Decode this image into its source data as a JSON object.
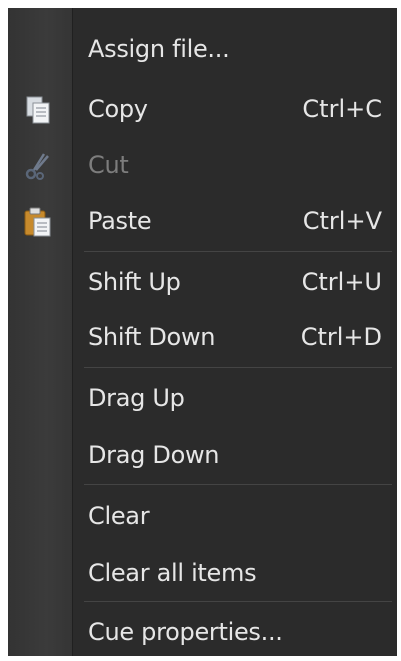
{
  "menu": {
    "items": [
      {
        "label": "Assign file...",
        "shortcut": "",
        "enabled": true,
        "icon": null
      },
      {
        "label": "Copy",
        "shortcut": "Ctrl+C",
        "enabled": true,
        "icon": "copy-icon"
      },
      {
        "label": "Cut",
        "shortcut": "",
        "enabled": false,
        "icon": "scissors-icon"
      },
      {
        "label": "Paste",
        "shortcut": "Ctrl+V",
        "enabled": true,
        "icon": "clipboard-paste-icon"
      },
      {
        "label": "Shift Up",
        "shortcut": "Ctrl+U",
        "enabled": true,
        "icon": null
      },
      {
        "label": "Shift Down",
        "shortcut": "Ctrl+D",
        "enabled": true,
        "icon": null
      },
      {
        "label": "Drag Up",
        "shortcut": "",
        "enabled": true,
        "icon": null
      },
      {
        "label": "Drag Down",
        "shortcut": "",
        "enabled": true,
        "icon": null
      },
      {
        "label": "Clear",
        "shortcut": "",
        "enabled": true,
        "icon": null
      },
      {
        "label": "Clear all items",
        "shortcut": "",
        "enabled": true,
        "icon": null
      },
      {
        "label": "Cue properties...",
        "shortcut": "",
        "enabled": true,
        "icon": null
      }
    ]
  },
  "colors": {
    "menu_background": "#2b2b2b",
    "text": "#e6e6e6",
    "disabled_text": "#7d7d7d",
    "separator": "#444444"
  }
}
